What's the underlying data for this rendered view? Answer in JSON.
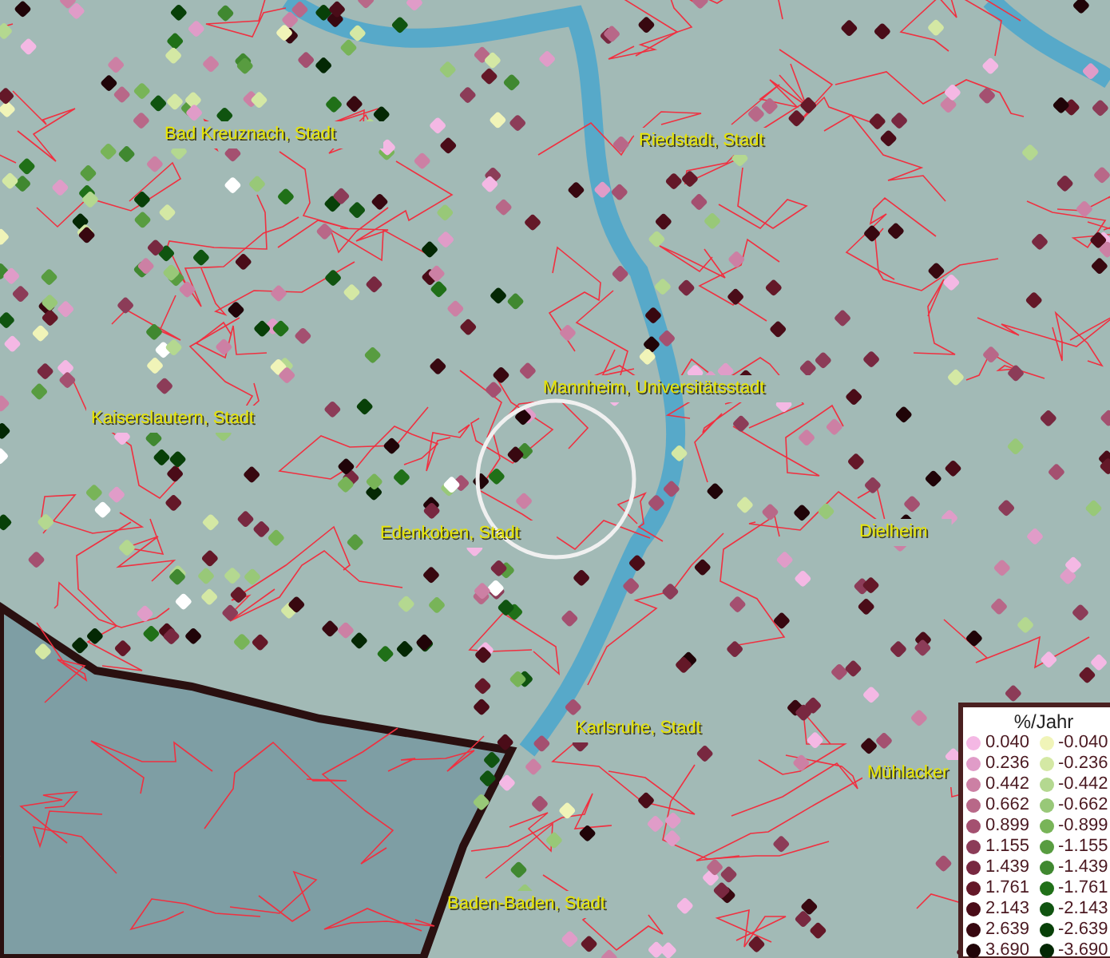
{
  "map": {
    "places": [
      {
        "name": "Bad Kreuznach, Stadt"
      },
      {
        "name": "Riedstadt, Stadt"
      },
      {
        "name": "Kaiserslautern, Stadt"
      },
      {
        "name": "Mannheim, Universitätsstadt"
      },
      {
        "name": "Edenkoben, Stadt"
      },
      {
        "name": "Dielheim"
      },
      {
        "name": "Karlsruhe, Stadt"
      },
      {
        "name": "Mühlacker"
      },
      {
        "name": "Baden-Baden, Stadt"
      }
    ]
  },
  "legend": {
    "title": "%/Jahr",
    "positive": [
      {
        "value": "0.040",
        "color": "#f4b8e4"
      },
      {
        "value": "0.236",
        "color": "#e09cc8"
      },
      {
        "value": "0.442",
        "color": "#cc80a4"
      },
      {
        "value": "0.662",
        "color": "#b86888"
      },
      {
        "value": "0.899",
        "color": "#a45070"
      },
      {
        "value": "1.155",
        "color": "#8c3c58"
      },
      {
        "value": "1.439",
        "color": "#782840"
      },
      {
        "value": "1.761",
        "color": "#641828"
      },
      {
        "value": "2.143",
        "color": "#4a0c18"
      },
      {
        "value": "2.639",
        "color": "#380810"
      },
      {
        "value": "3.690",
        "color": "#200408"
      }
    ],
    "negative": [
      {
        "value": "-0.040",
        "color": "#f0f4b8"
      },
      {
        "value": "-0.236",
        "color": "#d4e8a4"
      },
      {
        "value": "-0.442",
        "color": "#b4d890"
      },
      {
        "value": "-0.662",
        "color": "#98c878"
      },
      {
        "value": "-0.899",
        "color": "#78b458"
      },
      {
        "value": "-1.155",
        "color": "#589c40"
      },
      {
        "value": "-1.439",
        "color": "#408830"
      },
      {
        "value": "-1.761",
        "color": "#207018"
      },
      {
        "value": "-2.143",
        "color": "#105410"
      },
      {
        "value": "-2.639",
        "color": "#084008"
      },
      {
        "value": "-3.690",
        "color": "#042804"
      }
    ]
  }
}
